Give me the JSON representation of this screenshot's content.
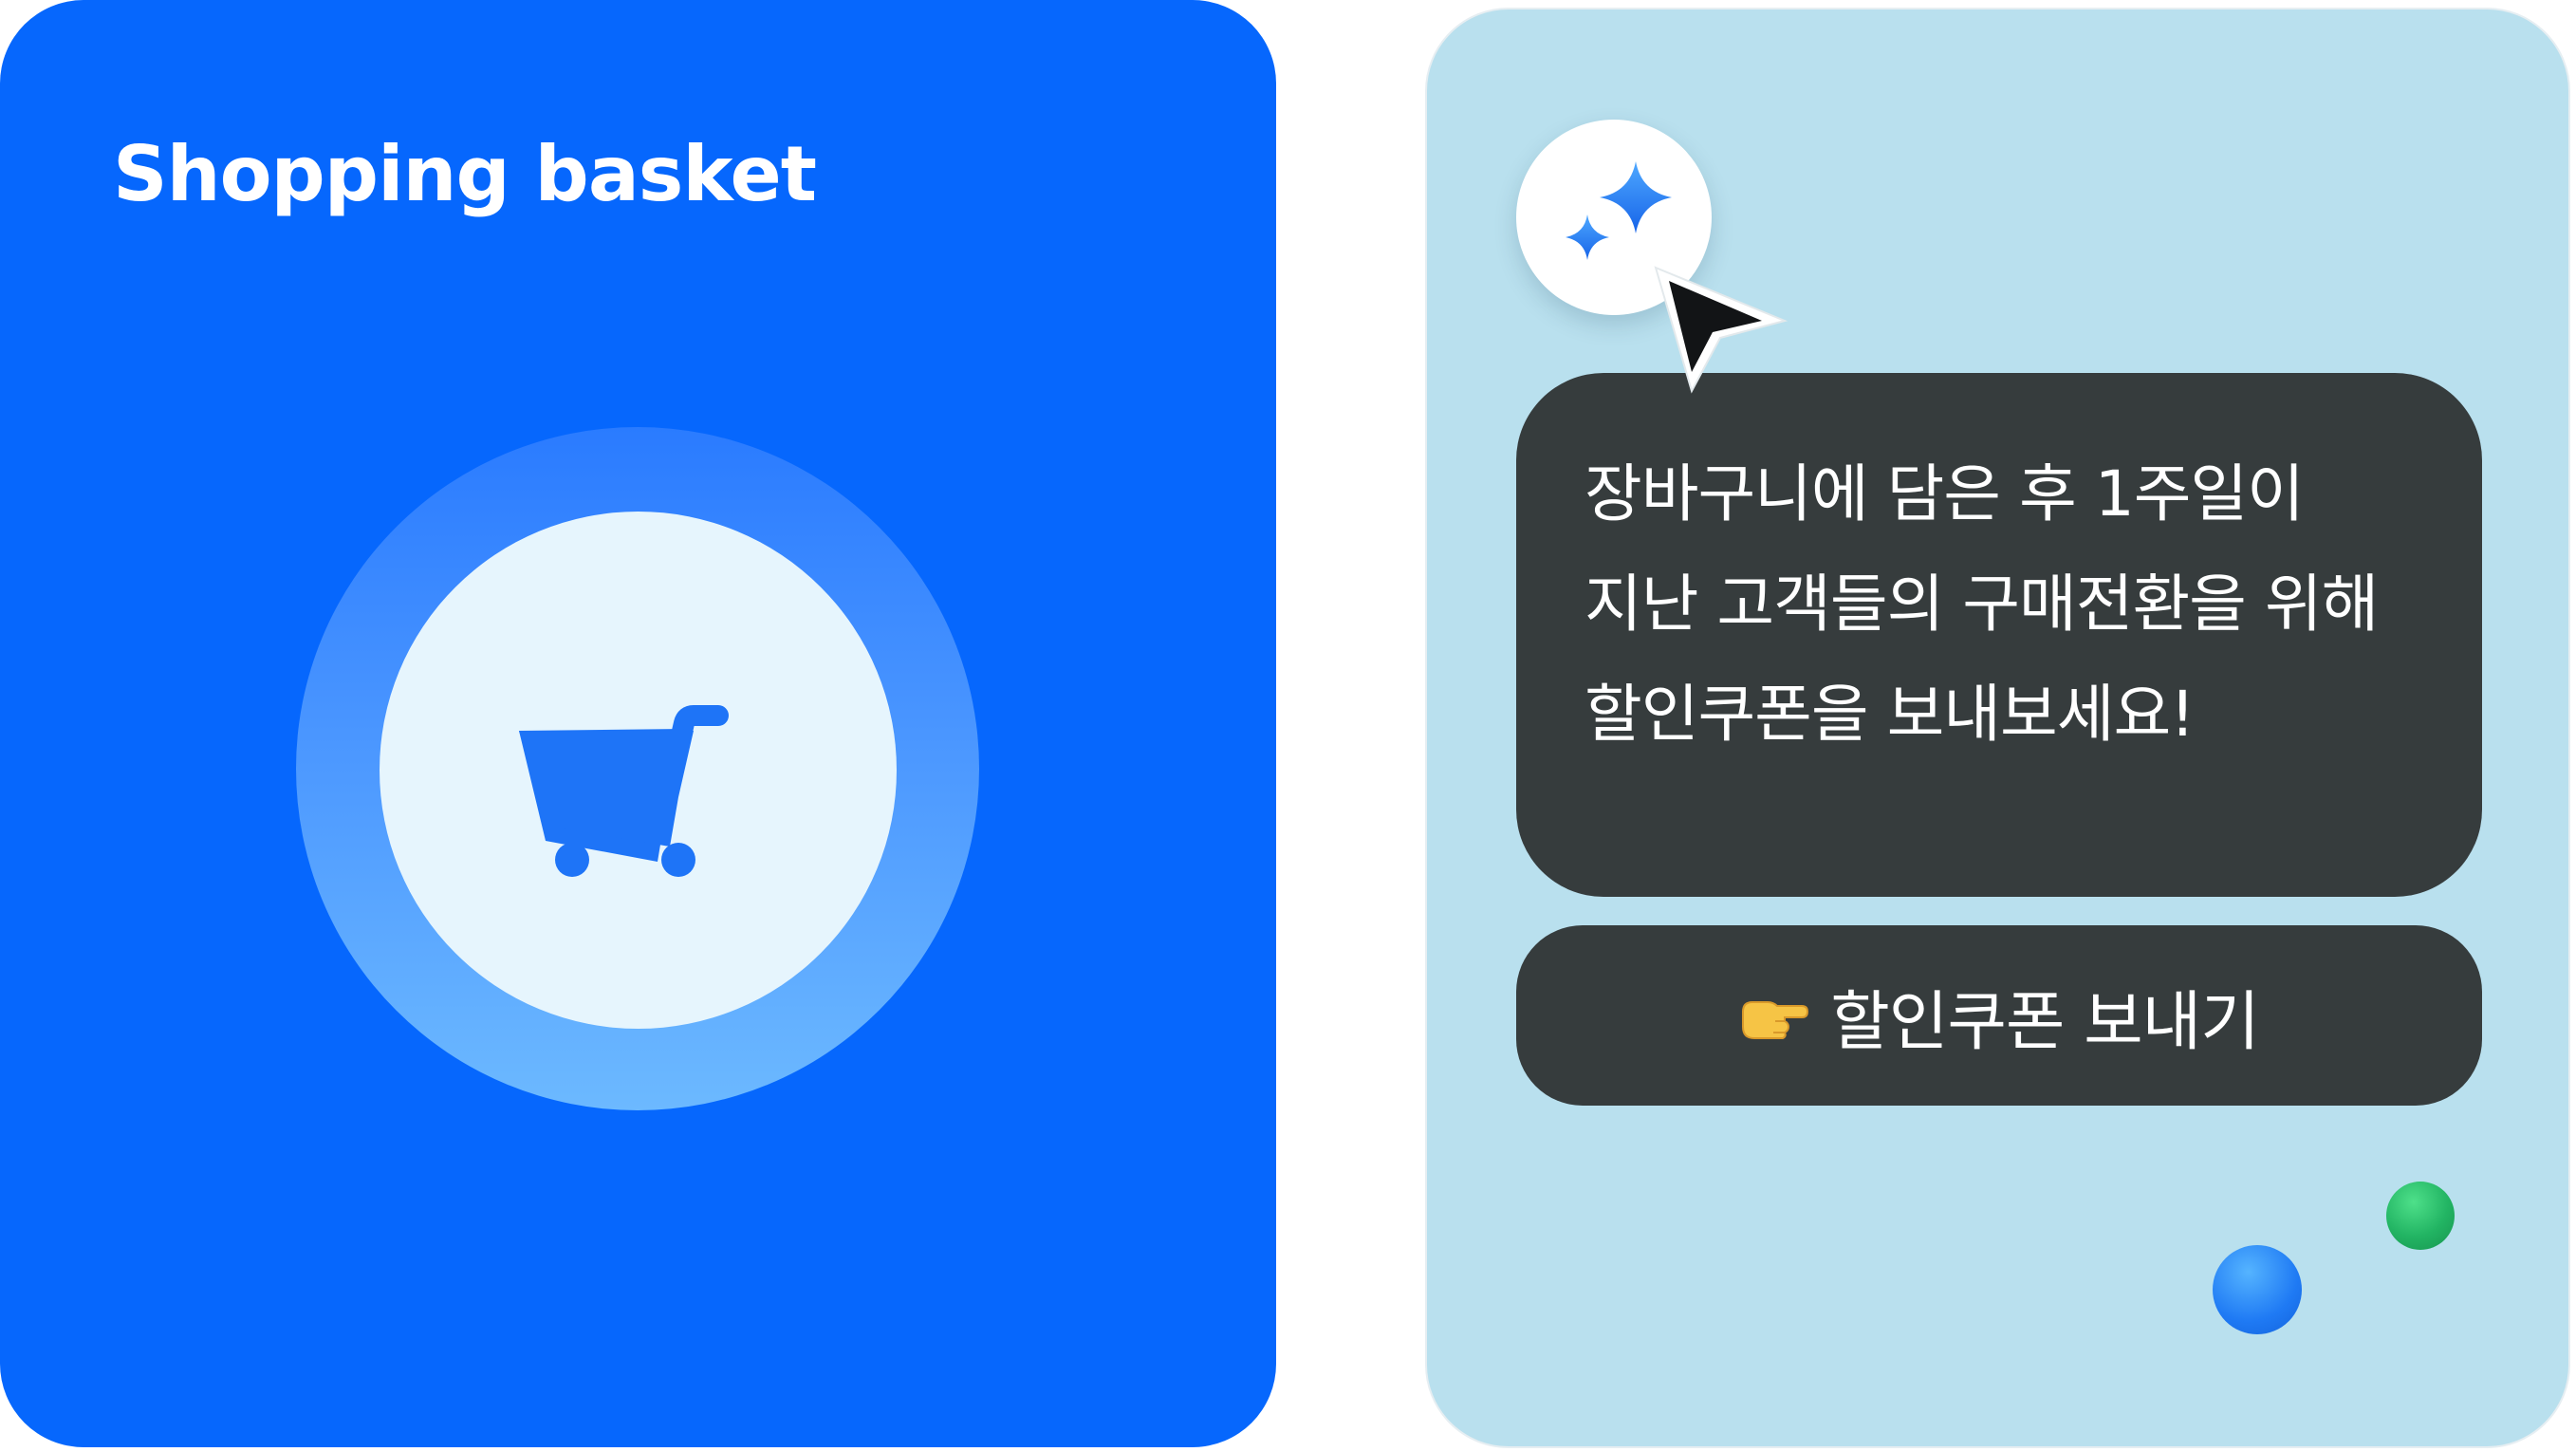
{
  "basket_card": {
    "title": "Shopping basket",
    "background_color": "#0667fd",
    "icon": "shopping-cart-icon"
  },
  "promo_card": {
    "background_color": "#b9e0ee",
    "badge_icon": "sparkle-icon",
    "cursor_icon": "mouse-pointer-icon",
    "message": "장바구니에 담은 후 1주일이\n지난 고객들의 구매전환을 위해\n할인쿠폰을 보내보세요!",
    "button": {
      "icon": "backhand-index-pointing-right-icon",
      "label": "할인쿠폰 보내기"
    },
    "decor_dots": [
      "#22b463",
      "#1f7af4"
    ]
  }
}
